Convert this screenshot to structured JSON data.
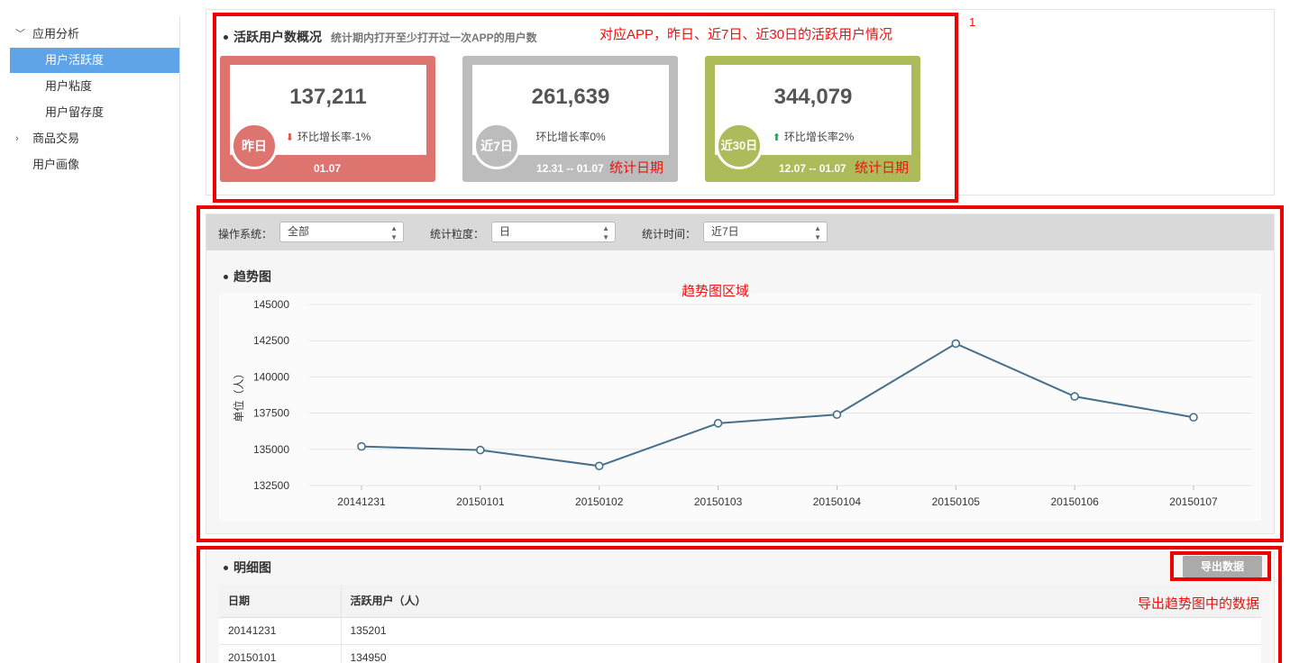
{
  "sidebar": {
    "items": [
      {
        "label": "应用分析",
        "expanded": true,
        "children": [
          {
            "label": "用户活跃度",
            "active": true
          },
          {
            "label": "用户粘度",
            "active": false
          },
          {
            "label": "用户留存度",
            "active": false
          }
        ]
      },
      {
        "label": "商品交易",
        "expanded": false
      },
      {
        "label": "用户画像"
      }
    ]
  },
  "overview": {
    "title": "活跃用户数概况",
    "desc": "统计期内打开至少打开过一次APP的用户数",
    "cards": [
      {
        "badge": "昨日",
        "value": "137,211",
        "growth": "环比增长率-1%",
        "trend": "down",
        "date": "01.07",
        "color": "#dd7470"
      },
      {
        "badge": "近7日",
        "value": "261,639",
        "growth": "环比增长率0%",
        "trend": "none",
        "date": "12.31 -- 01.07",
        "color": "#bcbcbc"
      },
      {
        "badge": "近30日",
        "value": "344,079",
        "growth": "环比增长率2%",
        "trend": "up",
        "date": "12.07 -- 01.07",
        "color": "#adbb5b"
      }
    ]
  },
  "annotations": {
    "marker": "1",
    "overview": "对应APP，昨日、近7日、近30日的活跃用户情况",
    "date_label_1": "统计日期",
    "date_label_2": "统计日期",
    "trend": "趋势图区域",
    "export": "导出趋势图中的数据"
  },
  "filters": {
    "os_label": "操作系统：",
    "os_value": "全部",
    "granularity_label": "统计粒度：",
    "granularity_value": "日",
    "time_label": "统计时间：",
    "time_value": "近7日"
  },
  "trend": {
    "title": "趋势图"
  },
  "chart_data": {
    "type": "line",
    "title": "",
    "xlabel": "",
    "ylabel": "单位（人）",
    "ylim": [
      132500,
      145000
    ],
    "yticks": [
      145000,
      142500,
      140000,
      137500,
      135000,
      132500
    ],
    "categories": [
      "20141231",
      "20150101",
      "20150102",
      "20150103",
      "20150104",
      "20150105",
      "20150106",
      "20150107"
    ],
    "values": [
      135201,
      134950,
      133850,
      136800,
      137400,
      142300,
      138650,
      137211
    ],
    "line_color": "#44708c",
    "grid": true
  },
  "detail": {
    "title": "明细图",
    "export_label": "导出数据",
    "columns": [
      "日期",
      "活跃用户（人）"
    ],
    "rows": [
      [
        "20141231",
        "135201"
      ],
      [
        "20150101",
        "134950"
      ]
    ]
  }
}
